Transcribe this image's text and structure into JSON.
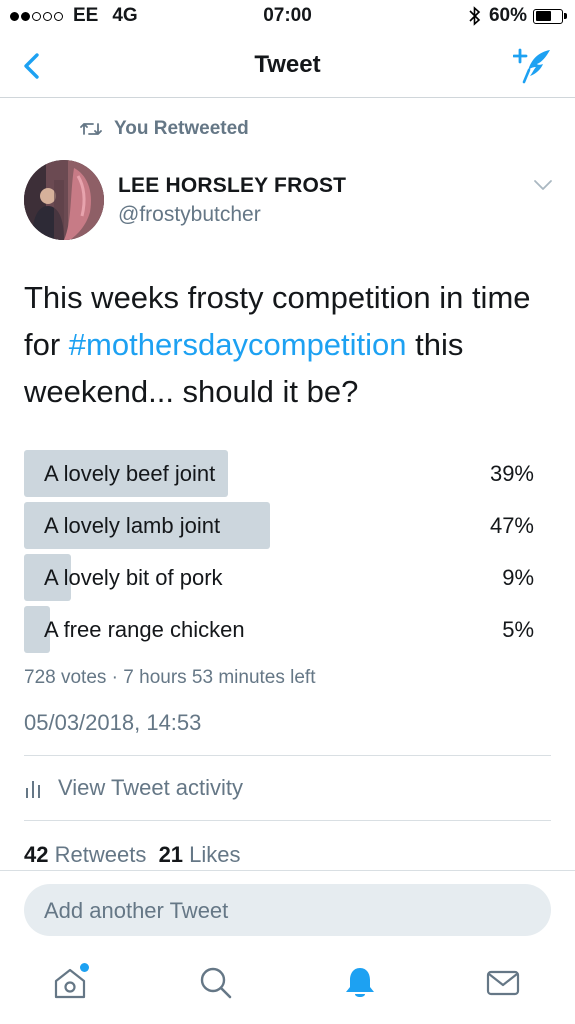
{
  "status_bar": {
    "carrier": "EE",
    "network": "4G",
    "time": "07:00",
    "battery": "60%",
    "battery_level": 0.6
  },
  "nav": {
    "title": "Tweet",
    "back_icon": "chevron-left-icon",
    "compose_icon": "compose-tweet-icon"
  },
  "retweet_context": {
    "label": "You Retweeted",
    "icon": "retweet-icon"
  },
  "author": {
    "name": "LEE HORSLEY FROST",
    "handle": "@frostybutcher"
  },
  "tweet": {
    "text_before": "This weeks frosty competition in time for ",
    "hashtag": "#mothersdaycompetition",
    "text_after": " this weekend... should it be?"
  },
  "poll": {
    "options": [
      {
        "label": "A lovely beef joint",
        "percent": "39%",
        "fraction": 0.39
      },
      {
        "label": "A lovely lamb joint",
        "percent": "47%",
        "fraction": 0.47
      },
      {
        "label": "A lovely bit of pork",
        "percent": "9%",
        "fraction": 0.09
      },
      {
        "label": "A free range chicken",
        "percent": "5%",
        "fraction": 0.05
      }
    ],
    "meta": "728 votes · 7 hours 53 minutes left"
  },
  "timestamp": "05/03/2018, 14:53",
  "activity": {
    "label": "View Tweet activity"
  },
  "stats": {
    "retweets_count": "42",
    "retweets_label": "Retweets",
    "likes_count": "21",
    "likes_label": "Likes"
  },
  "reply": {
    "placeholder": "Add another Tweet"
  },
  "colors": {
    "accent": "#1da1f2",
    "secondary_text": "#657786",
    "poll_bar": "#ccd6dd"
  },
  "tabbar": {
    "items": [
      {
        "icon": "home-icon",
        "has_badge": true
      },
      {
        "icon": "search-icon"
      },
      {
        "icon": "notifications-bell-icon",
        "active": true
      },
      {
        "icon": "messages-envelope-icon"
      }
    ]
  }
}
